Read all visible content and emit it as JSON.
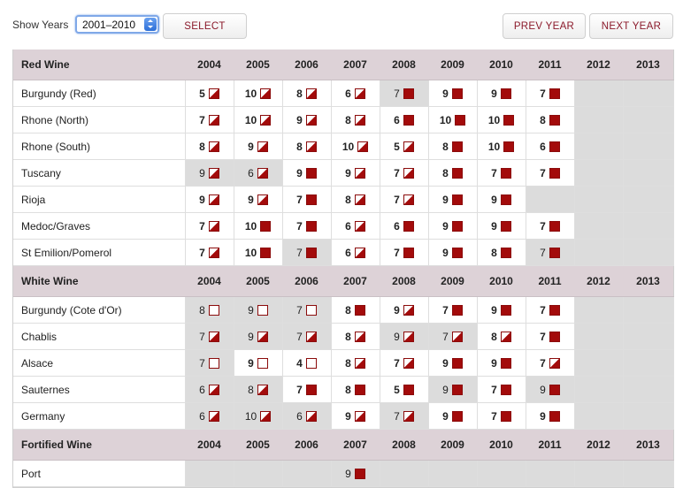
{
  "toolbar": {
    "show_years_label": "Show Years",
    "year_range_value": "2001–2010",
    "select_label": "SELECT",
    "prev_label": "PREV YEAR",
    "next_label": "NEXT YEAR"
  },
  "colors": {
    "accent": "#8b1a2b",
    "full_icon": "#a30b0b",
    "section_bg": "#ddd2d7",
    "shade": "#dcdcdc"
  },
  "icons": {
    "full": "ready-to-drink-icon",
    "half": "can-drink-icon",
    "empty": "hold-icon"
  },
  "years": [
    "2004",
    "2005",
    "2006",
    "2007",
    "2008",
    "2009",
    "2010",
    "2011",
    "2012",
    "2013"
  ],
  "sections": [
    {
      "title": "Red Wine",
      "rows": [
        {
          "name": "Burgundy (Red)",
          "cells": [
            {
              "s": "5",
              "i": "half"
            },
            {
              "s": "10",
              "i": "half"
            },
            {
              "s": "8",
              "i": "half"
            },
            {
              "s": "6",
              "i": "half"
            },
            {
              "s": "7",
              "i": "full",
              "g": true
            },
            {
              "s": "9",
              "i": "full"
            },
            {
              "s": "9",
              "i": "full"
            },
            {
              "s": "7",
              "i": "full"
            },
            {
              "e": true
            },
            {
              "e": true
            }
          ]
        },
        {
          "name": "Rhone (North)",
          "cells": [
            {
              "s": "7",
              "i": "half"
            },
            {
              "s": "10",
              "i": "half"
            },
            {
              "s": "9",
              "i": "half"
            },
            {
              "s": "8",
              "i": "half"
            },
            {
              "s": "6",
              "i": "full"
            },
            {
              "s": "10",
              "i": "full"
            },
            {
              "s": "10",
              "i": "full"
            },
            {
              "s": "8",
              "i": "full"
            },
            {
              "e": true
            },
            {
              "e": true
            }
          ]
        },
        {
          "name": "Rhone (South)",
          "cells": [
            {
              "s": "8",
              "i": "half"
            },
            {
              "s": "9",
              "i": "half"
            },
            {
              "s": "8",
              "i": "half"
            },
            {
              "s": "10",
              "i": "half"
            },
            {
              "s": "5",
              "i": "half"
            },
            {
              "s": "8",
              "i": "full"
            },
            {
              "s": "10",
              "i": "full"
            },
            {
              "s": "6",
              "i": "full"
            },
            {
              "e": true
            },
            {
              "e": true
            }
          ]
        },
        {
          "name": "Tuscany",
          "cells": [
            {
              "s": "9",
              "i": "half",
              "g": true
            },
            {
              "s": "6",
              "i": "half",
              "g": true
            },
            {
              "s": "9",
              "i": "full"
            },
            {
              "s": "9",
              "i": "half"
            },
            {
              "s": "7",
              "i": "half"
            },
            {
              "s": "8",
              "i": "full"
            },
            {
              "s": "7",
              "i": "full"
            },
            {
              "s": "7",
              "i": "full"
            },
            {
              "e": true
            },
            {
              "e": true
            }
          ]
        },
        {
          "name": "Rioja",
          "cells": [
            {
              "s": "9",
              "i": "half"
            },
            {
              "s": "9",
              "i": "half"
            },
            {
              "s": "7",
              "i": "full"
            },
            {
              "s": "8",
              "i": "half"
            },
            {
              "s": "7",
              "i": "half"
            },
            {
              "s": "9",
              "i": "full"
            },
            {
              "s": "9",
              "i": "full"
            },
            {
              "e": true
            },
            {
              "e": true
            },
            {
              "e": true
            }
          ]
        },
        {
          "name": "Medoc/Graves",
          "cells": [
            {
              "s": "7",
              "i": "half"
            },
            {
              "s": "10",
              "i": "full"
            },
            {
              "s": "7",
              "i": "full"
            },
            {
              "s": "6",
              "i": "half"
            },
            {
              "s": "6",
              "i": "full"
            },
            {
              "s": "9",
              "i": "full"
            },
            {
              "s": "9",
              "i": "full"
            },
            {
              "s": "7",
              "i": "full"
            },
            {
              "e": true
            },
            {
              "e": true
            }
          ]
        },
        {
          "name": "St Emilion/Pomerol",
          "cells": [
            {
              "s": "7",
              "i": "half"
            },
            {
              "s": "10",
              "i": "full"
            },
            {
              "s": "7",
              "i": "full",
              "g": true
            },
            {
              "s": "6",
              "i": "half"
            },
            {
              "s": "7",
              "i": "full"
            },
            {
              "s": "9",
              "i": "full"
            },
            {
              "s": "8",
              "i": "full"
            },
            {
              "s": "7",
              "i": "full",
              "g": true
            },
            {
              "e": true
            },
            {
              "e": true
            }
          ]
        }
      ]
    },
    {
      "title": "White Wine",
      "rows": [
        {
          "name": "Burgundy (Cote d'Or)",
          "cells": [
            {
              "s": "8",
              "i": "empty",
              "g": true
            },
            {
              "s": "9",
              "i": "empty",
              "g": true
            },
            {
              "s": "7",
              "i": "empty",
              "g": true
            },
            {
              "s": "8",
              "i": "full"
            },
            {
              "s": "9",
              "i": "half"
            },
            {
              "s": "7",
              "i": "full"
            },
            {
              "s": "9",
              "i": "full"
            },
            {
              "s": "7",
              "i": "full"
            },
            {
              "e": true
            },
            {
              "e": true
            }
          ]
        },
        {
          "name": "Chablis",
          "cells": [
            {
              "s": "7",
              "i": "half",
              "g": true
            },
            {
              "s": "9",
              "i": "half",
              "g": true
            },
            {
              "s": "7",
              "i": "half",
              "g": true
            },
            {
              "s": "8",
              "i": "half"
            },
            {
              "s": "9",
              "i": "half",
              "g": true
            },
            {
              "s": "7",
              "i": "half",
              "g": true
            },
            {
              "s": "8",
              "i": "half"
            },
            {
              "s": "7",
              "i": "full"
            },
            {
              "e": true
            },
            {
              "e": true
            }
          ]
        },
        {
          "name": "Alsace",
          "cells": [
            {
              "s": "7",
              "i": "empty",
              "g": true
            },
            {
              "s": "9",
              "i": "empty"
            },
            {
              "s": "4",
              "i": "empty"
            },
            {
              "s": "8",
              "i": "half"
            },
            {
              "s": "7",
              "i": "half"
            },
            {
              "s": "9",
              "i": "full"
            },
            {
              "s": "9",
              "i": "full"
            },
            {
              "s": "7",
              "i": "half"
            },
            {
              "e": true
            },
            {
              "e": true
            }
          ]
        },
        {
          "name": "Sauternes",
          "cells": [
            {
              "s": "6",
              "i": "half",
              "g": true
            },
            {
              "s": "8",
              "i": "half",
              "g": true
            },
            {
              "s": "7",
              "i": "full"
            },
            {
              "s": "8",
              "i": "full"
            },
            {
              "s": "5",
              "i": "full"
            },
            {
              "s": "9",
              "i": "full",
              "g": true
            },
            {
              "s": "7",
              "i": "full"
            },
            {
              "s": "9",
              "i": "full",
              "g": true
            },
            {
              "e": true
            },
            {
              "e": true
            }
          ]
        },
        {
          "name": "Germany",
          "cells": [
            {
              "s": "6",
              "i": "half",
              "g": true
            },
            {
              "s": "10",
              "i": "half",
              "g": true
            },
            {
              "s": "6",
              "i": "half",
              "g": true
            },
            {
              "s": "9",
              "i": "half"
            },
            {
              "s": "7",
              "i": "half",
              "g": true
            },
            {
              "s": "9",
              "i": "full"
            },
            {
              "s": "7",
              "i": "full"
            },
            {
              "s": "9",
              "i": "full"
            },
            {
              "e": true
            },
            {
              "e": true
            }
          ]
        }
      ]
    },
    {
      "title": "Fortified Wine",
      "rows": [
        {
          "name": "Port",
          "cells": [
            {
              "e": true
            },
            {
              "e": true
            },
            {
              "e": true
            },
            {
              "s": "9",
              "i": "full",
              "g": true
            },
            {
              "e": true
            },
            {
              "e": true
            },
            {
              "e": true
            },
            {
              "e": true
            },
            {
              "e": true
            },
            {
              "e": true
            }
          ]
        }
      ]
    }
  ]
}
